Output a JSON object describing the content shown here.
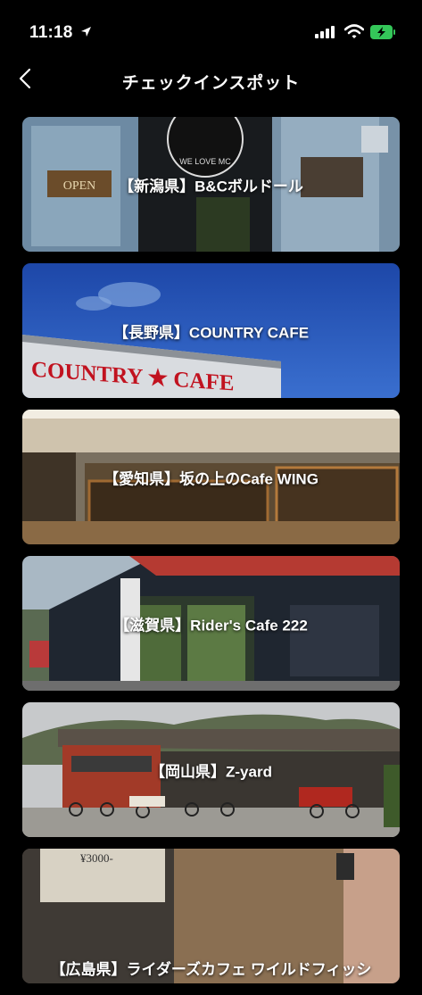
{
  "status": {
    "time": "11:18",
    "icons": [
      "location-arrow-icon",
      "cellular-signal-icon",
      "wifi-icon",
      "battery-charging-icon"
    ],
    "battery_color": "#34c759"
  },
  "nav": {
    "title": "チェックインスポット",
    "back_icon": "chevron-left-icon"
  },
  "spots": [
    {
      "label": "【新潟県】B&Cボルドール"
    },
    {
      "label": "【長野県】COUNTRY CAFE"
    },
    {
      "label": "【愛知県】坂の上のCafe WING"
    },
    {
      "label": "【滋賀県】Rider's Cafe 222"
    },
    {
      "label": "【岡山県】Z-yard"
    },
    {
      "label": "【広島県】ライダーズカフェ ワイルドフィッシ"
    }
  ],
  "photo_text": {
    "spot1_open_sign": "OPEN",
    "spot1_logo": "WE LOVE MC",
    "spot2_sign": "COUNTRY ★ CAFE",
    "spot6_price": "¥3000-"
  }
}
